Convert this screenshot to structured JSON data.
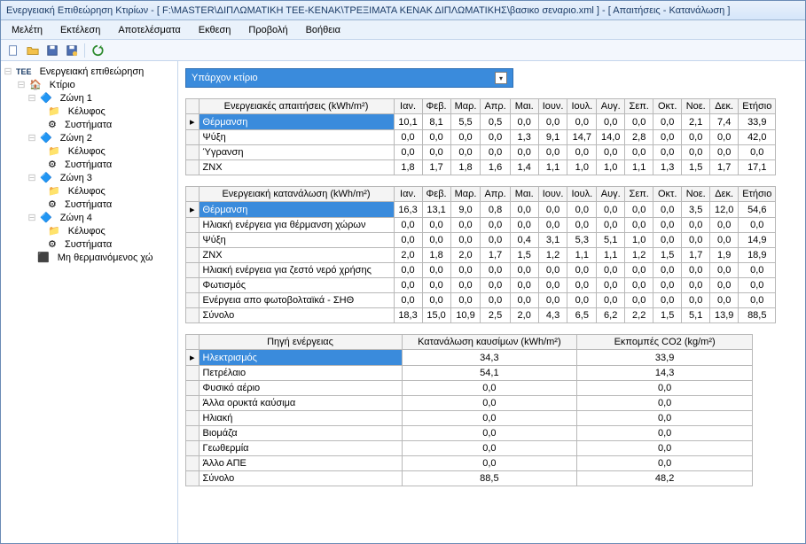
{
  "title": "Ενεργειακή Επιθεώρηση Κτιρίων - [ F:\\MASTER\\ΔΙΠΛΩΜΑΤΙΚΗ ΤΕΕ-ΚΕΝΑΚ\\ΤΡΕΞΙΜΑΤΑ ΚΕΝΑΚ ΔΙΠΛΩΜΑΤΙΚΗΣ\\βασικο σεναριο.xml ] - [ Απαιτήσεις - Κατανάλωση ]",
  "menu": {
    "m0": "Μελέτη",
    "m1": "Εκτέλεση",
    "m2": "Αποτελέσματα",
    "m3": "Εκθεση",
    "m4": "Προβολή",
    "m5": "Βοήθεια"
  },
  "tree": {
    "root": "Ενεργειακή επιθεώρηση",
    "building": "Κτίριο",
    "zone1": "Ζώνη 1",
    "zone2": "Ζώνη 2",
    "zone3": "Ζώνη 3",
    "zone4": "Ζώνη 4",
    "shell": "Κέλυφος",
    "systems": "Συστήματα",
    "unheated": "Μη θερμαινόμενος χώ"
  },
  "dropdown": {
    "label": "Υπάρχον κτίριο"
  },
  "months": {
    "c0": "Ιαν.",
    "c1": "Φεβ.",
    "c2": "Μαρ.",
    "c3": "Απρ.",
    "c4": "Μαι.",
    "c5": "Ιουν.",
    "c6": "Ιουλ.",
    "c7": "Αυγ.",
    "c8": "Σεπ.",
    "c9": "Οκτ.",
    "c10": "Νοε.",
    "c11": "Δεκ.",
    "c12": "Ετήσιο"
  },
  "table1": {
    "header": "Ενεργειακές απαιτήσεις (kWh/m²)",
    "rows": [
      {
        "label": "Θέρμανση",
        "sel": true,
        "v": [
          "10,1",
          "8,1",
          "5,5",
          "0,5",
          "0,0",
          "0,0",
          "0,0",
          "0,0",
          "0,0",
          "0,0",
          "2,1",
          "7,4",
          "33,9"
        ]
      },
      {
        "label": "Ψύξη",
        "v": [
          "0,0",
          "0,0",
          "0,0",
          "0,0",
          "1,3",
          "9,1",
          "14,7",
          "14,0",
          "2,8",
          "0,0",
          "0,0",
          "0,0",
          "42,0"
        ]
      },
      {
        "label": "Ύγρανση",
        "v": [
          "0,0",
          "0,0",
          "0,0",
          "0,0",
          "0,0",
          "0,0",
          "0,0",
          "0,0",
          "0,0",
          "0,0",
          "0,0",
          "0,0",
          "0,0"
        ]
      },
      {
        "label": "ZNX",
        "v": [
          "1,8",
          "1,7",
          "1,8",
          "1,6",
          "1,4",
          "1,1",
          "1,0",
          "1,0",
          "1,1",
          "1,3",
          "1,5",
          "1,7",
          "17,1"
        ]
      }
    ]
  },
  "table2": {
    "header": "Ενεργειακή κατανάλωση (kWh/m²)",
    "rows": [
      {
        "label": "Θέρμανση",
        "sel": true,
        "v": [
          "16,3",
          "13,1",
          "9,0",
          "0,8",
          "0,0",
          "0,0",
          "0,0",
          "0,0",
          "0,0",
          "0,0",
          "3,5",
          "12,0",
          "54,6"
        ]
      },
      {
        "label": "Ηλιακή ενέργεια για θέρμανση χώρων",
        "v": [
          "0,0",
          "0,0",
          "0,0",
          "0,0",
          "0,0",
          "0,0",
          "0,0",
          "0,0",
          "0,0",
          "0,0",
          "0,0",
          "0,0",
          "0,0"
        ]
      },
      {
        "label": "Ψύξη",
        "v": [
          "0,0",
          "0,0",
          "0,0",
          "0,0",
          "0,4",
          "3,1",
          "5,3",
          "5,1",
          "1,0",
          "0,0",
          "0,0",
          "0,0",
          "14,9"
        ]
      },
      {
        "label": "ZNX",
        "v": [
          "2,0",
          "1,8",
          "2,0",
          "1,7",
          "1,5",
          "1,2",
          "1,1",
          "1,1",
          "1,2",
          "1,5",
          "1,7",
          "1,9",
          "18,9"
        ]
      },
      {
        "label": "Ηλιακή ενέργεια για ζεστό νερό χρήσης",
        "v": [
          "0,0",
          "0,0",
          "0,0",
          "0,0",
          "0,0",
          "0,0",
          "0,0",
          "0,0",
          "0,0",
          "0,0",
          "0,0",
          "0,0",
          "0,0"
        ]
      },
      {
        "label": "Φωτισμός",
        "v": [
          "0,0",
          "0,0",
          "0,0",
          "0,0",
          "0,0",
          "0,0",
          "0,0",
          "0,0",
          "0,0",
          "0,0",
          "0,0",
          "0,0",
          "0,0"
        ]
      },
      {
        "label": "Ενέργεια απο φωτοβολταϊκά - ΣΗΘ",
        "v": [
          "0,0",
          "0,0",
          "0,0",
          "0,0",
          "0,0",
          "0,0",
          "0,0",
          "0,0",
          "0,0",
          "0,0",
          "0,0",
          "0,0",
          "0,0"
        ]
      },
      {
        "label": "Σύνολο",
        "v": [
          "18,3",
          "15,0",
          "10,9",
          "2,5",
          "2,0",
          "4,3",
          "6,5",
          "6,2",
          "2,2",
          "1,5",
          "5,1",
          "13,9",
          "88,5"
        ]
      }
    ]
  },
  "table3": {
    "h0": "Πηγή ενέργειας",
    "h1": "Κατανάλωση καυσίμων (kWh/m²)",
    "h2": "Εκπομπές CO2 (kg/m²)",
    "rows": [
      {
        "label": "Ηλεκτρισμός",
        "sel": true,
        "v": [
          "34,3",
          "33,9"
        ]
      },
      {
        "label": "Πετρέλαιο",
        "v": [
          "54,1",
          "14,3"
        ]
      },
      {
        "label": "Φυσικό αέριο",
        "v": [
          "0,0",
          "0,0"
        ]
      },
      {
        "label": "Άλλα ορυκτά καύσιμα",
        "v": [
          "0,0",
          "0,0"
        ]
      },
      {
        "label": "Ηλιακή",
        "v": [
          "0,0",
          "0,0"
        ]
      },
      {
        "label": "Βιομάζα",
        "v": [
          "0,0",
          "0,0"
        ]
      },
      {
        "label": "Γεωθερμία",
        "v": [
          "0,0",
          "0,0"
        ]
      },
      {
        "label": "Άλλο ΑΠΕ",
        "v": [
          "0,0",
          "0,0"
        ]
      },
      {
        "label": "Σύνολο",
        "v": [
          "88,5",
          "48,2"
        ]
      }
    ]
  },
  "chart_data": [
    {
      "type": "table",
      "title": "Ενεργειακές απαιτήσεις (kWh/m²)",
      "categories": [
        "Ιαν.",
        "Φεβ.",
        "Μαρ.",
        "Απρ.",
        "Μαι.",
        "Ιουν.",
        "Ιουλ.",
        "Αυγ.",
        "Σεπ.",
        "Οκτ.",
        "Νοε.",
        "Δεκ.",
        "Ετήσιο"
      ],
      "series": [
        {
          "name": "Θέρμανση",
          "values": [
            10.1,
            8.1,
            5.5,
            0.5,
            0,
            0,
            0,
            0,
            0,
            0,
            2.1,
            7.4,
            33.9
          ]
        },
        {
          "name": "Ψύξη",
          "values": [
            0,
            0,
            0,
            0,
            1.3,
            9.1,
            14.7,
            14.0,
            2.8,
            0,
            0,
            0,
            42.0
          ]
        },
        {
          "name": "Ύγρανση",
          "values": [
            0,
            0,
            0,
            0,
            0,
            0,
            0,
            0,
            0,
            0,
            0,
            0,
            0
          ]
        },
        {
          "name": "ZNX",
          "values": [
            1.8,
            1.7,
            1.8,
            1.6,
            1.4,
            1.1,
            1.0,
            1.0,
            1.1,
            1.3,
            1.5,
            1.7,
            17.1
          ]
        }
      ]
    },
    {
      "type": "table",
      "title": "Ενεργειακή κατανάλωση (kWh/m²)",
      "categories": [
        "Ιαν.",
        "Φεβ.",
        "Μαρ.",
        "Απρ.",
        "Μαι.",
        "Ιουν.",
        "Ιουλ.",
        "Αυγ.",
        "Σεπ.",
        "Οκτ.",
        "Νοε.",
        "Δεκ.",
        "Ετήσιο"
      ],
      "series": [
        {
          "name": "Θέρμανση",
          "values": [
            16.3,
            13.1,
            9.0,
            0.8,
            0,
            0,
            0,
            0,
            0,
            0,
            3.5,
            12.0,
            54.6
          ]
        },
        {
          "name": "Ηλιακή ενέργεια για θέρμανση χώρων",
          "values": [
            0,
            0,
            0,
            0,
            0,
            0,
            0,
            0,
            0,
            0,
            0,
            0,
            0
          ]
        },
        {
          "name": "Ψύξη",
          "values": [
            0,
            0,
            0,
            0,
            0.4,
            3.1,
            5.3,
            5.1,
            1.0,
            0,
            0,
            0,
            14.9
          ]
        },
        {
          "name": "ZNX",
          "values": [
            2.0,
            1.8,
            2.0,
            1.7,
            1.5,
            1.2,
            1.1,
            1.1,
            1.2,
            1.5,
            1.7,
            1.9,
            18.9
          ]
        },
        {
          "name": "Ηλιακή ενέργεια για ζεστό νερό χρήσης",
          "values": [
            0,
            0,
            0,
            0,
            0,
            0,
            0,
            0,
            0,
            0,
            0,
            0,
            0
          ]
        },
        {
          "name": "Φωτισμός",
          "values": [
            0,
            0,
            0,
            0,
            0,
            0,
            0,
            0,
            0,
            0,
            0,
            0,
            0
          ]
        },
        {
          "name": "Ενέργεια απο φωτοβολταϊκά - ΣΗΘ",
          "values": [
            0,
            0,
            0,
            0,
            0,
            0,
            0,
            0,
            0,
            0,
            0,
            0,
            0
          ]
        },
        {
          "name": "Σύνολο",
          "values": [
            18.3,
            15.0,
            10.9,
            2.5,
            2.0,
            4.3,
            6.5,
            6.2,
            2.2,
            1.5,
            5.1,
            13.9,
            88.5
          ]
        }
      ]
    },
    {
      "type": "table",
      "title": "Πηγή ενέργειας",
      "columns": [
        "Κατανάλωση καυσίμων (kWh/m²)",
        "Εκπομπές CO2 (kg/m²)"
      ],
      "series": [
        {
          "name": "Ηλεκτρισμός",
          "values": [
            34.3,
            33.9
          ]
        },
        {
          "name": "Πετρέλαιο",
          "values": [
            54.1,
            14.3
          ]
        },
        {
          "name": "Φυσικό αέριο",
          "values": [
            0,
            0
          ]
        },
        {
          "name": "Άλλα ορυκτά καύσιμα",
          "values": [
            0,
            0
          ]
        },
        {
          "name": "Ηλιακή",
          "values": [
            0,
            0
          ]
        },
        {
          "name": "Βιομάζα",
          "values": [
            0,
            0
          ]
        },
        {
          "name": "Γεωθερμία",
          "values": [
            0,
            0
          ]
        },
        {
          "name": "Άλλο ΑΠΕ",
          "values": [
            0,
            0
          ]
        },
        {
          "name": "Σύνολο",
          "values": [
            88.5,
            48.2
          ]
        }
      ]
    }
  ]
}
